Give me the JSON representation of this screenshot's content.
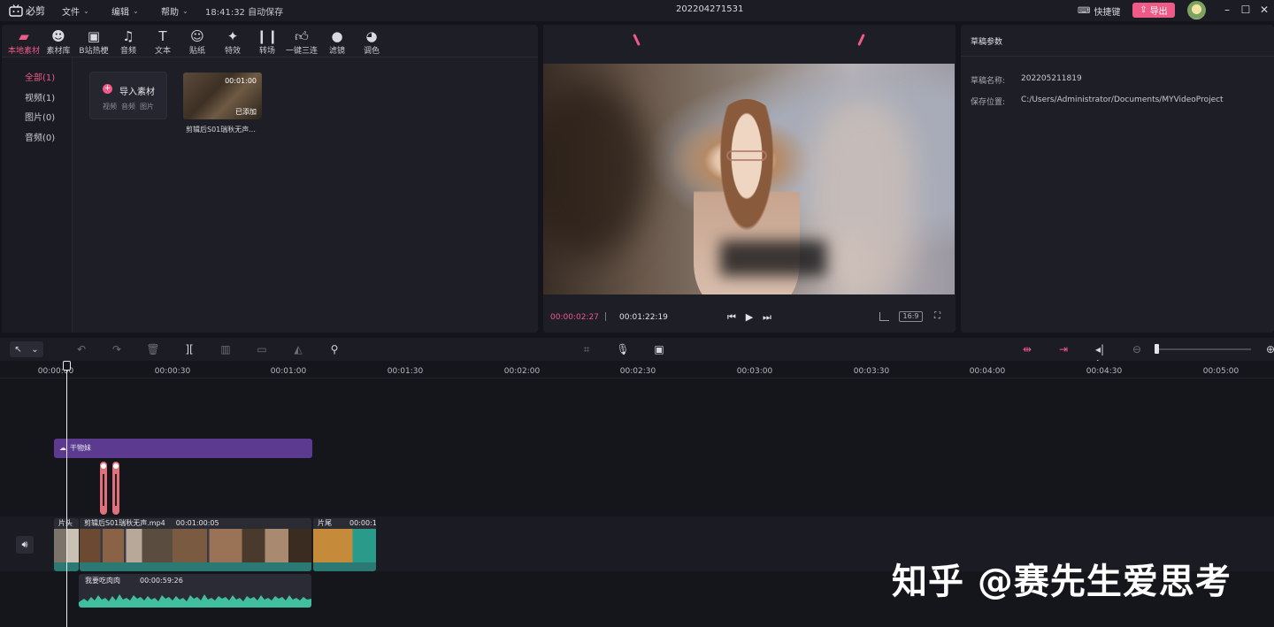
{
  "titlebar": {
    "app_name": "必剪",
    "menus": [
      "文件",
      "编辑",
      "帮助"
    ],
    "save_status": "18:41:32 自动保存",
    "project_name": "202204271531",
    "shortcut_label": "快捷键",
    "export_label": "导出"
  },
  "media": {
    "tabs": [
      {
        "label": "本地素材",
        "icon": "folder-icon"
      },
      {
        "label": "素材库",
        "icon": "ghost-icon"
      },
      {
        "label": "B站热梗",
        "icon": "bilibili-tv-icon"
      },
      {
        "label": "音频",
        "icon": "music-note-icon"
      },
      {
        "label": "文本",
        "icon": "text-icon"
      },
      {
        "label": "贴纸",
        "icon": "sticker-icon"
      },
      {
        "label": "特效",
        "icon": "effects-star-icon"
      },
      {
        "label": "转场",
        "icon": "transition-icon"
      },
      {
        "label": "一键三连",
        "icon": "thumbs-up-icon"
      },
      {
        "label": "滤镜",
        "icon": "filter-circles-icon"
      },
      {
        "label": "调色",
        "icon": "palette-icon"
      }
    ],
    "categories": [
      "全部(1)",
      "视频(1)",
      "图片(0)",
      "音频(0)"
    ],
    "import": {
      "label": "导入素材",
      "types": [
        "视频",
        "音频",
        "图片"
      ]
    },
    "clip": {
      "duration": "00:01:00",
      "status": "已添加",
      "name": "剪辑后S01瑞秋无声..."
    }
  },
  "preview": {
    "current_time": "00:00:02:27",
    "total_time": "00:01:22:19",
    "ratio": "16:9"
  },
  "params": {
    "title": "草稿参数",
    "name_label": "草稿名称:",
    "name_value": "202205211819",
    "location_label": "保存位置:",
    "location_value": "C:/Users/Administrator/Documents/MYVideoProject"
  },
  "timeline": {
    "ruler": [
      "00:00:00",
      "00:00:30",
      "00:01:00",
      "00:01:30",
      "00:02:00",
      "00:02:30",
      "00:03:00",
      "00:03:30",
      "00:04:00",
      "00:04:30",
      "00:05:00"
    ],
    "text_clip": "干物妹",
    "head_clip": "片头",
    "main_clip": {
      "name": "剪辑后S01瑞秋无声.mp4",
      "duration": "00:01:00:05"
    },
    "tail_clip": {
      "name": "片尾",
      "duration": "00:00:1"
    },
    "audio_clip": {
      "name": "我要吃肉肉",
      "duration": "00:00:59:26"
    }
  },
  "watermark": "知乎 @赛先生爱思考",
  "colors": {
    "accent": "#ef5a86",
    "text_clip": "#5b3a8f",
    "audio_wave": "#3fbf9f"
  }
}
